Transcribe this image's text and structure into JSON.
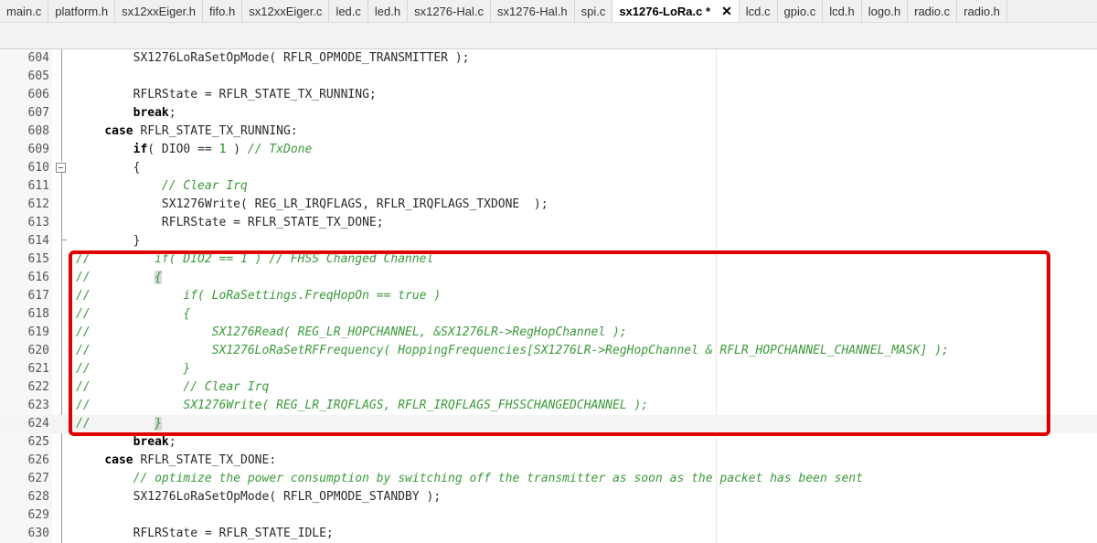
{
  "tabs": [
    {
      "label": "main.c",
      "active": false
    },
    {
      "label": "platform.h",
      "active": false
    },
    {
      "label": "sx12xxEiger.h",
      "active": false
    },
    {
      "label": "fifo.h",
      "active": false
    },
    {
      "label": "sx12xxEiger.c",
      "active": false
    },
    {
      "label": "led.c",
      "active": false
    },
    {
      "label": "led.h",
      "active": false
    },
    {
      "label": "sx1276-Hal.c",
      "active": false
    },
    {
      "label": "sx1276-Hal.h",
      "active": false
    },
    {
      "label": "spi.c",
      "active": false
    },
    {
      "label": "sx1276-LoRa.c *",
      "active": true
    },
    {
      "label": "lcd.c",
      "active": false
    },
    {
      "label": "gpio.c",
      "active": false
    },
    {
      "label": "lcd.h",
      "active": false
    },
    {
      "label": "logo.h",
      "active": false
    },
    {
      "label": "radio.c",
      "active": false
    },
    {
      "label": "radio.h",
      "active": false
    }
  ],
  "close_glyph": "✕",
  "lines": [
    {
      "n": "604",
      "segs": [
        {
          "t": "        SX1276LoRaSetOpMode( RFLR_OPMODE_TRANSMITTER );",
          "c": ""
        }
      ]
    },
    {
      "n": "605",
      "segs": []
    },
    {
      "n": "606",
      "segs": [
        {
          "t": "        RFLRState = RFLR_STATE_TX_RUNNING;",
          "c": ""
        }
      ]
    },
    {
      "n": "607",
      "segs": [
        {
          "t": "        ",
          "c": ""
        },
        {
          "t": "break",
          "c": "kw"
        },
        {
          "t": ";",
          "c": ""
        }
      ]
    },
    {
      "n": "608",
      "segs": [
        {
          "t": "    ",
          "c": ""
        },
        {
          "t": "case",
          "c": "kw"
        },
        {
          "t": " RFLR_STATE_TX_RUNNING:",
          "c": ""
        }
      ]
    },
    {
      "n": "609",
      "segs": [
        {
          "t": "        ",
          "c": ""
        },
        {
          "t": "if",
          "c": "kw"
        },
        {
          "t": "( DIO0 == ",
          "c": ""
        },
        {
          "t": "1",
          "c": "num"
        },
        {
          "t": " ) ",
          "c": ""
        },
        {
          "t": "// TxDone",
          "c": "cm"
        }
      ]
    },
    {
      "n": "610",
      "segs": [
        {
          "t": "        {",
          "c": ""
        }
      ]
    },
    {
      "n": "611",
      "segs": [
        {
          "t": "            ",
          "c": ""
        },
        {
          "t": "// Clear Irq",
          "c": "cm"
        }
      ]
    },
    {
      "n": "612",
      "segs": [
        {
          "t": "            SX1276Write( REG_LR_IRQFLAGS, RFLR_IRQFLAGS_TXDONE  );",
          "c": ""
        }
      ]
    },
    {
      "n": "613",
      "segs": [
        {
          "t": "            RFLRState = RFLR_STATE_TX_DONE;",
          "c": ""
        }
      ]
    },
    {
      "n": "614",
      "segs": [
        {
          "t": "        }",
          "c": ""
        }
      ]
    },
    {
      "n": "615",
      "segs": [
        {
          "t": "//         if( DIO2 == 1 ) // FHSS Changed Channel",
          "c": "cm"
        }
      ]
    },
    {
      "n": "616",
      "segs": [
        {
          "t": "//         ",
          "c": "cm"
        },
        {
          "t": "{",
          "c": "cm br"
        }
      ]
    },
    {
      "n": "617",
      "segs": [
        {
          "t": "//             if( LoRaSettings.FreqHopOn == true )",
          "c": "cm"
        }
      ]
    },
    {
      "n": "618",
      "segs": [
        {
          "t": "//             {",
          "c": "cm"
        }
      ]
    },
    {
      "n": "619",
      "segs": [
        {
          "t": "//                 SX1276Read( REG_LR_HOPCHANNEL, &SX1276LR->RegHopChannel );",
          "c": "cm"
        }
      ]
    },
    {
      "n": "620",
      "segs": [
        {
          "t": "//                 SX1276LoRaSetRFFrequency( HoppingFrequencies[SX1276LR->RegHopChannel & RFLR_HOPCHANNEL_CHANNEL_MASK] );",
          "c": "cm"
        }
      ]
    },
    {
      "n": "621",
      "segs": [
        {
          "t": "//             }",
          "c": "cm"
        }
      ]
    },
    {
      "n": "622",
      "segs": [
        {
          "t": "//             // Clear Irq",
          "c": "cm"
        }
      ]
    },
    {
      "n": "623",
      "segs": [
        {
          "t": "//             SX1276Write( REG_LR_IRQFLAGS, RFLR_IRQFLAGS_FHSSCHANGEDCHANNEL );",
          "c": "cm"
        }
      ]
    },
    {
      "n": "624",
      "segs": [
        {
          "t": "//         ",
          "c": "cm"
        },
        {
          "t": "}",
          "c": "cm br"
        }
      ],
      "current": true
    },
    {
      "n": "625",
      "segs": [
        {
          "t": "        ",
          "c": ""
        },
        {
          "t": "break",
          "c": "kw"
        },
        {
          "t": ";",
          "c": ""
        }
      ]
    },
    {
      "n": "626",
      "segs": [
        {
          "t": "    ",
          "c": ""
        },
        {
          "t": "case",
          "c": "kw"
        },
        {
          "t": " RFLR_STATE_TX_DONE:",
          "c": ""
        }
      ]
    },
    {
      "n": "627",
      "segs": [
        {
          "t": "        ",
          "c": ""
        },
        {
          "t": "// optimize the power consumption by switching off the transmitter as soon as the packet has been sent",
          "c": "cm"
        }
      ]
    },
    {
      "n": "628",
      "segs": [
        {
          "t": "        SX1276LoRaSetOpMode( RFLR_OPMODE_STANDBY );",
          "c": ""
        }
      ]
    },
    {
      "n": "629",
      "segs": []
    },
    {
      "n": "630",
      "segs": [
        {
          "t": "        RFLRState = RFLR_STATE_IDLE;",
          "c": ""
        }
      ]
    }
  ]
}
